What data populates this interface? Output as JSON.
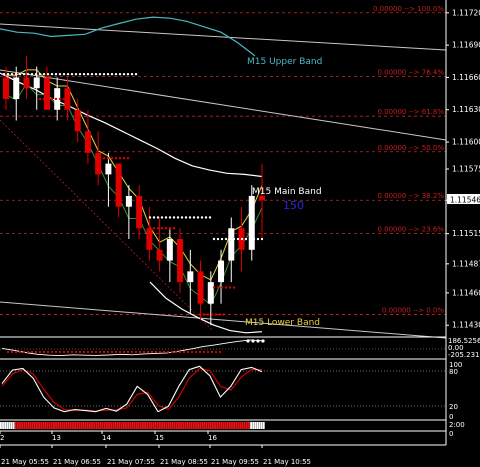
{
  "chart_data": {
    "type": "candlestick",
    "colors": {
      "background": "#000000",
      "axis": "#ffffff",
      "fib": "#cc2222",
      "fib_label": "#c81e1e",
      "bull": "#ffffff",
      "bear": "#e00000",
      "upper_band": "#49b8c8",
      "main_band": "#ffffff",
      "lower_band": "#ffffff",
      "yellow": "#e8d040",
      "green": "#3ca03c",
      "price_box": "#ffffff",
      "accent_blue": "#2b2bd6",
      "cci": "#ffffff",
      "stoch_main": "#ffffff",
      "stoch_signal": "#e00000"
    },
    "price_axis": {
      "labels": [
        "1.11720",
        "1.11690",
        "1.11660",
        "1.11630",
        "1.11600",
        "1.11575",
        "1.11546",
        "1.11515",
        "1.11487",
        "1.11460",
        "1.11430"
      ],
      "current": "1.11546",
      "ylim": [
        1.1142,
        1.1173
      ]
    },
    "fib_levels": [
      {
        "label": "0.00000 --> 100.0%",
        "price": 1.1172
      },
      {
        "label": "0.00000 --> 76.4%",
        "price": 1.11661
      },
      {
        "label": "0.00000 --> 61.8%",
        "price": 1.11624
      },
      {
        "label": "0.00000 --> 50.0%",
        "price": 1.11591
      },
      {
        "label": "0.00000 --> 38.2%",
        "price": 1.11546
      },
      {
        "label": "0.00000 --> 23.6%",
        "price": 1.11515
      },
      {
        "label": "0.00000 --> 0.0%",
        "price": 1.1144
      }
    ],
    "annotations": {
      "upper_band": "M15 Upper Band",
      "main_band": "M15 Main Band",
      "lower_band": "M15 Lower Band",
      "marker": "150"
    },
    "candles_ohlc": [
      [
        1.1166,
        1.1167,
        1.1163,
        1.1164
      ],
      [
        1.1164,
        1.1167,
        1.1162,
        1.1166
      ],
      [
        1.1166,
        1.1168,
        1.1164,
        1.1165
      ],
      [
        1.1165,
        1.1167,
        1.1163,
        1.1166
      ],
      [
        1.1166,
        1.1167,
        1.1163,
        1.1163
      ],
      [
        1.1163,
        1.1166,
        1.1162,
        1.1165
      ],
      [
        1.1165,
        1.1166,
        1.1162,
        1.1163
      ],
      [
        1.1163,
        1.1164,
        1.116,
        1.1161
      ],
      [
        1.1161,
        1.1163,
        1.1158,
        1.1159
      ],
      [
        1.1159,
        1.1161,
        1.1156,
        1.1157
      ],
      [
        1.1157,
        1.1159,
        1.1154,
        1.1158
      ],
      [
        1.1158,
        1.1158,
        1.1153,
        1.1154
      ],
      [
        1.1154,
        1.1156,
        1.1151,
        1.1155
      ],
      [
        1.1155,
        1.1156,
        1.1151,
        1.1152
      ],
      [
        1.1152,
        1.1154,
        1.1149,
        1.115
      ],
      [
        1.115,
        1.1153,
        1.1148,
        1.1149
      ],
      [
        1.1149,
        1.1152,
        1.1147,
        1.1151
      ],
      [
        1.1151,
        1.1152,
        1.1146,
        1.1147
      ],
      [
        1.1147,
        1.115,
        1.1144,
        1.1148
      ],
      [
        1.1148,
        1.1149,
        1.11435,
        1.1145
      ],
      [
        1.1145,
        1.1148,
        1.1143,
        1.1147
      ],
      [
        1.1147,
        1.115,
        1.1145,
        1.1149
      ],
      [
        1.1149,
        1.1153,
        1.1147,
        1.1152
      ],
      [
        1.1152,
        1.1154,
        1.1148,
        1.115
      ],
      [
        1.115,
        1.1156,
        1.1149,
        1.1155
      ],
      [
        1.1155,
        1.1158,
        1.1151,
        1.11546
      ]
    ],
    "upper_band_values": [
      1.11705,
      1.11702,
      1.11701,
      1.11698,
      1.11699,
      1.117,
      1.11706,
      1.1171,
      1.11714,
      1.11716,
      1.11715,
      1.11712,
      1.11707,
      1.11702,
      1.11692,
      1.1168
    ],
    "main_band_values": [
      1.11664,
      1.11656,
      1.11649,
      1.1164,
      1.11633,
      1.11625,
      1.11618,
      1.1161,
      1.11602,
      1.11594,
      1.11585,
      1.11578,
      1.11574,
      1.11571,
      1.1157,
      1.11568
    ],
    "lower_band_values": [
      1.1147,
      1.11455,
      1.11445,
      1.11437,
      1.1143,
      1.11425,
      1.11423,
      1.11424
    ],
    "cci": {
      "label_top": "186.5256",
      "label_zero": "0.00",
      "label_bottom": "-205.231",
      "ylim": [
        -210,
        190
      ],
      "values": [
        -20,
        -60,
        -110,
        -150,
        -170,
        -180,
        -160,
        -170,
        -175,
        -165,
        -150,
        -160,
        -140,
        -130,
        -120,
        -80,
        -30,
        20,
        60,
        100,
        140,
        170,
        150
      ]
    },
    "stochastic": {
      "labels": [
        "100",
        "80",
        "20",
        "0"
      ],
      "ylim": [
        0,
        100
      ],
      "main": [
        60,
        85,
        88,
        70,
        35,
        15,
        8,
        12,
        10,
        8,
        14,
        9,
        22,
        55,
        40,
        8,
        18,
        55,
        86,
        92,
        74,
        35,
        55,
        86,
        90,
        82
      ],
      "signal": [
        55,
        78,
        86,
        78,
        50,
        25,
        12,
        10,
        11,
        9,
        11,
        11,
        15,
        40,
        44,
        20,
        12,
        35,
        70,
        88,
        84,
        55,
        48,
        72,
        86,
        86
      ]
    },
    "bar_strip": {
      "blocks": [
        "w",
        "w",
        "w",
        "w",
        "w",
        "w",
        "w",
        "r",
        "r",
        "r",
        "r",
        "r",
        "r",
        "r",
        "r",
        "r",
        "r",
        "r",
        "r",
        "r",
        "r",
        "r",
        "r",
        "r",
        "r",
        "r",
        "r",
        "r",
        "r",
        "r",
        "r",
        "r",
        "r",
        "r",
        "r",
        "r",
        "r",
        "r",
        "r",
        "r",
        "r",
        "r",
        "r",
        "r",
        "r",
        "r",
        "r",
        "r",
        "r",
        "r",
        "r",
        "r",
        "r",
        "r",
        "r",
        "r",
        "r",
        "r",
        "r",
        "r",
        "r",
        "r",
        "r",
        "r",
        "r",
        "r",
        "r",
        "r",
        "r",
        "r",
        "r",
        "r",
        "r",
        "r",
        "r",
        "r",
        "r",
        "r",
        "r",
        "r",
        "r",
        "r",
        "r",
        "r",
        "r",
        "r",
        "r",
        "r",
        "r",
        "r",
        "r",
        "r",
        "r",
        "r",
        "r",
        "r",
        "r",
        "r",
        "r",
        "r",
        "r",
        "r",
        "r",
        "r",
        "r",
        "r",
        "r",
        "r",
        "r",
        "r",
        "r",
        "r",
        "r",
        "r",
        "r",
        "r",
        "r",
        "r",
        "w",
        "w",
        "w",
        "w",
        "w",
        "w",
        "w"
      ],
      "labels": [
        "2:00",
        "0"
      ]
    },
    "x_ticks_upper": [
      "2",
      "13",
      "14",
      "15",
      "16"
    ],
    "x_ticks_bottom": [
      "21 May 05:55",
      "21 May 06:55",
      "21 May 07:55",
      "21 May 08:55",
      "21 May 09:55",
      "21 May 10:55"
    ]
  }
}
